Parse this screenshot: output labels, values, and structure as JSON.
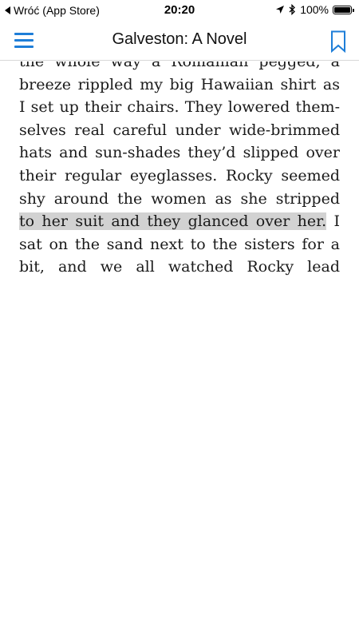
{
  "status_bar": {
    "back_label": "Wróć (App Store)",
    "time": "20:20",
    "battery_percent": "100%",
    "battery_level": 1.0
  },
  "nav": {
    "title": "Galveston: A Novel"
  },
  "reader": {
    "lines": [
      "the whole way a Romanian pegged, a",
      "breeze rippled my big Hawaiian shirt as",
      "I set up their chairs. They lowered them-",
      "selves real careful under wide-brimmed",
      "hats and sun-shades they’d slipped over",
      "their regular eyeglasses. Rocky seemed",
      "shy around the women as she stripped"
    ],
    "highlighted_text": "to her suit and they glanced over her.",
    "highlight_line_tail": " I",
    "line_after_highlight": "sat on the sand next to the sisters for a",
    "last_line": "bit, and we all watched Rocky lead"
  },
  "icons": {
    "menu": "hamburger-icon",
    "bookmark": "bookmark-icon",
    "location": "location-arrow-icon",
    "bluetooth": "bluetooth-icon",
    "battery": "battery-icon"
  },
  "colors": {
    "accent": "#1e7ed8",
    "highlight": "#d2d2d2"
  }
}
